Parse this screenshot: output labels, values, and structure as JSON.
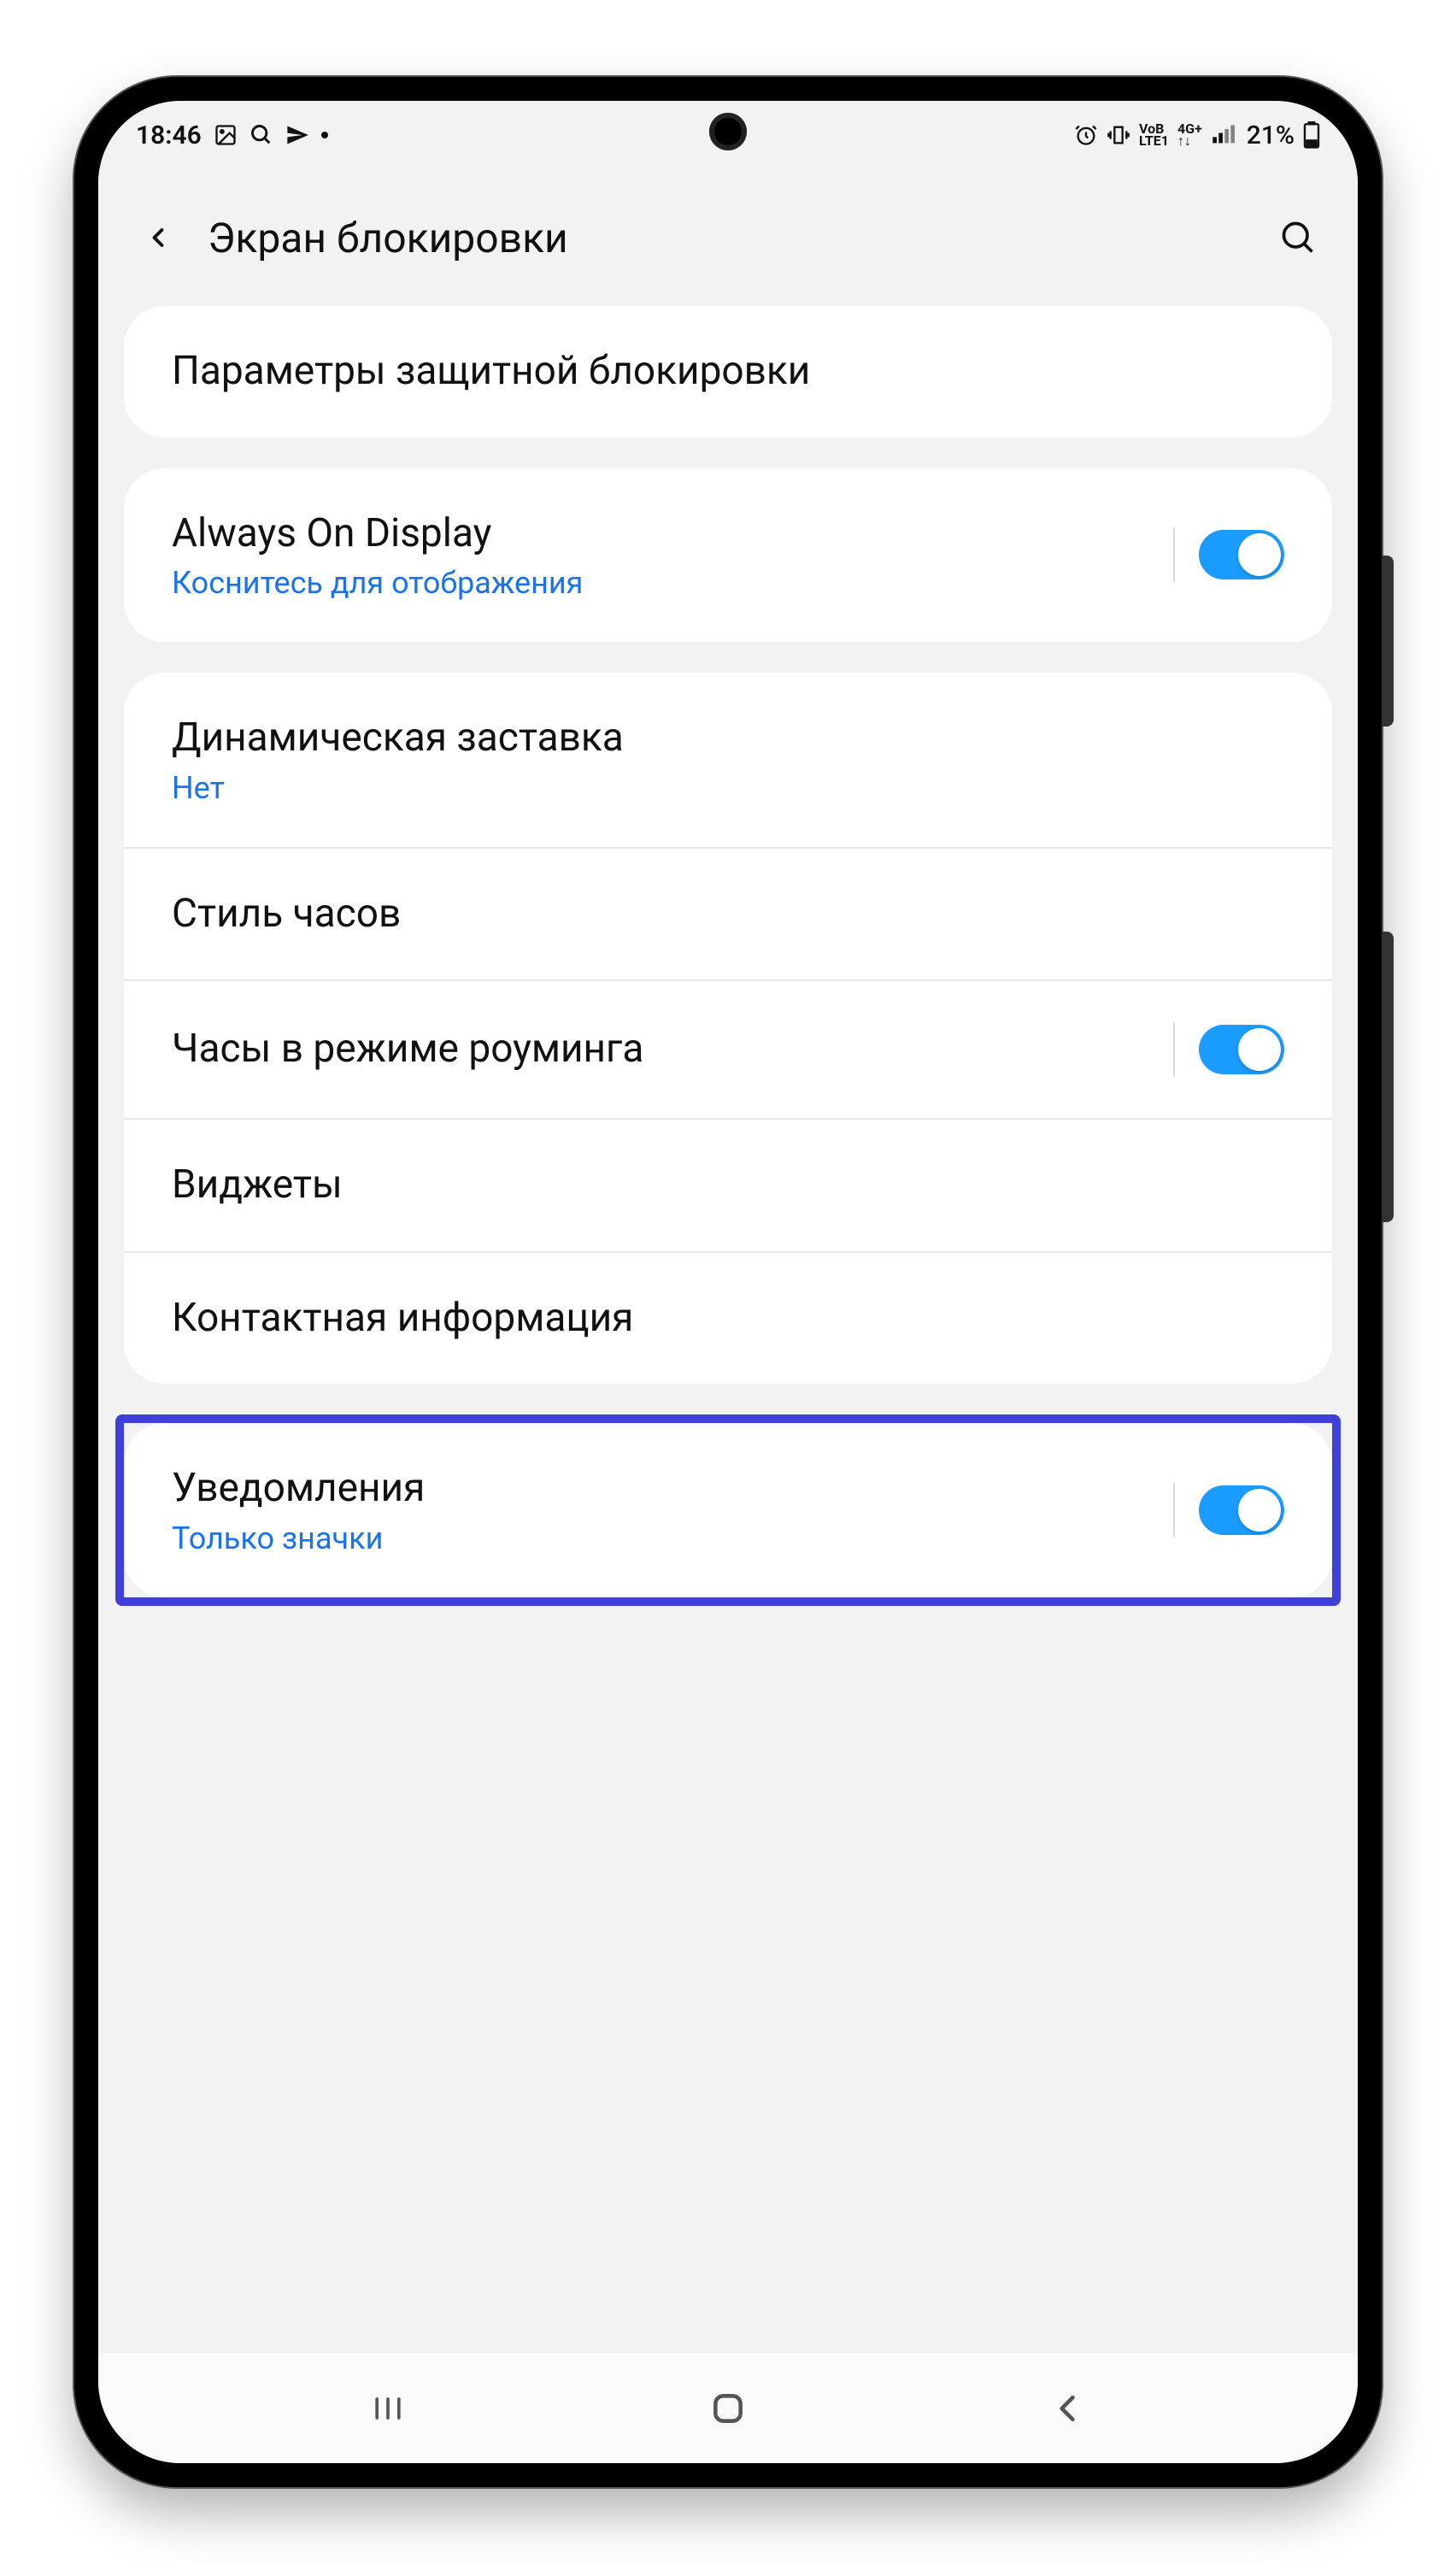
{
  "statusBar": {
    "time": "18:46",
    "battery": "21%"
  },
  "header": {
    "title": "Экран блокировки"
  },
  "group1": {
    "secureLockTitle": "Параметры защитной блокировки"
  },
  "group2": {
    "aodTitle": "Always On Display",
    "aodSub": "Коснитесь для отображения"
  },
  "group3": {
    "dynamicTitle": "Динамическая заставка",
    "dynamicSub": "Нет",
    "clockStyleTitle": "Стиль часов",
    "roamingClockTitle": "Часы в режиме роуминга",
    "widgetsTitle": "Виджеты",
    "contactInfoTitle": "Контактная информация"
  },
  "group4": {
    "notificationsTitle": "Уведомления",
    "notificationsSub": "Только значки"
  }
}
